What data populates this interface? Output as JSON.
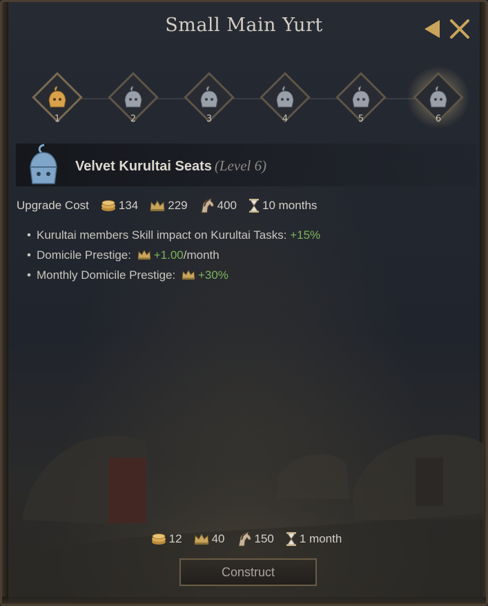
{
  "window": {
    "title": "Small Main Yurt",
    "back_icon": "back-arrow-icon",
    "close_icon": "close-icon"
  },
  "levels": [
    {
      "label": "1",
      "icon": "kurultai-icon",
      "state": "unlocked"
    },
    {
      "label": "2",
      "icon": "kurultai-icon",
      "state": "locked"
    },
    {
      "label": "3",
      "icon": "kurultai-icon",
      "state": "locked"
    },
    {
      "label": "4",
      "icon": "kurultai-icon",
      "state": "locked"
    },
    {
      "label": "5",
      "icon": "kurultai-icon",
      "state": "locked"
    },
    {
      "label": "6",
      "icon": "kurultai-icon",
      "state": "selected"
    }
  ],
  "selected": {
    "name": "Velvet Kurultai Seats",
    "level": "(Level 6)"
  },
  "upgrade_cost": {
    "label": "Upgrade Cost",
    "gold": "134",
    "prestige": "229",
    "herd": "400",
    "time": "10 months"
  },
  "effects": [
    {
      "text": "Kurultai members Skill impact on Kurultai Tasks: ",
      "value": "+15%",
      "suffix": ""
    },
    {
      "text": "Domicile Prestige: ",
      "value": "+1.00",
      "suffix": "/month"
    },
    {
      "text": "Monthly Domicile Prestige: ",
      "value": "+30%",
      "suffix": ""
    }
  ],
  "construct_cost": {
    "gold": "12",
    "prestige": "40",
    "herd": "150",
    "time": "1 month"
  },
  "construct_button": "Construct",
  "colors": {
    "gold_accent": "#c9a55c",
    "positive": "#7bb55a",
    "active_icon": "#d9a24a",
    "inactive_icon": "#9aa0aa",
    "header_icon": "#7fa6c9"
  }
}
